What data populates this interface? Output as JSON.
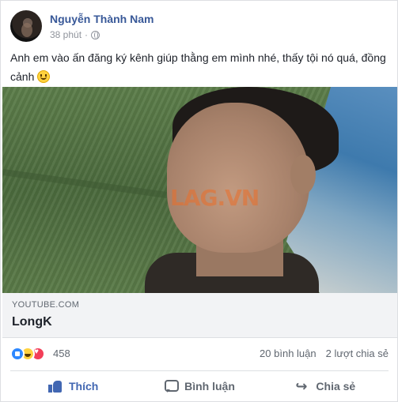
{
  "post": {
    "author": "Nguyễn Thành Nam",
    "time": "38 phút",
    "privacy_icon": "globe-icon",
    "text": "Anh em vào ấn đăng ký kênh giúp thằng em mình nhé, thấy tội nó quá, đồng cảnh",
    "emoji": "smiley-icon"
  },
  "link": {
    "domain": "YOUTUBE.COM",
    "title": "LongK",
    "watermark": "LAG.VN"
  },
  "stats": {
    "reaction_icons": [
      "like-icon",
      "haha-icon",
      "love-icon"
    ],
    "reaction_count": "458",
    "comments": "20 bình luận",
    "shares": "2 lượt chia sẻ"
  },
  "actions": {
    "like": "Thích",
    "comment": "Bình luận",
    "share": "Chia sẻ"
  },
  "colors": {
    "author_link": "#385898",
    "like_active": "#4267b2",
    "muted": "#606770"
  }
}
